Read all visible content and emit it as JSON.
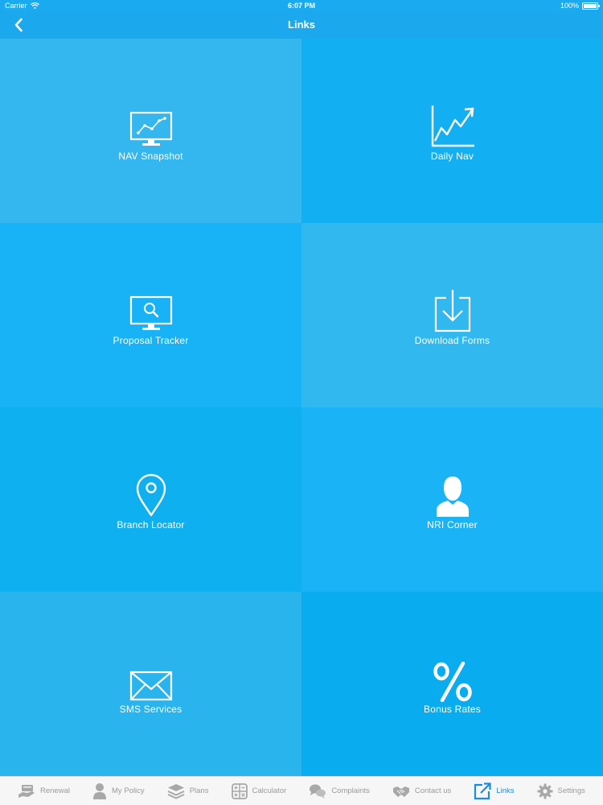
{
  "status_bar": {
    "carrier": "Carrier",
    "time": "6:07 PM",
    "battery": "100%"
  },
  "nav": {
    "title": "Links"
  },
  "tiles": [
    {
      "label": "NAV Snapshot",
      "icon": "monitor-chart-icon"
    },
    {
      "label": "Daily Nav",
      "icon": "line-chart-icon"
    },
    {
      "label": "Proposal Tracker",
      "icon": "monitor-search-icon"
    },
    {
      "label": "Download Forms",
      "icon": "download-icon"
    },
    {
      "label": "Branch Locator",
      "icon": "map-pin-icon"
    },
    {
      "label": "NRI Corner",
      "icon": "person-icon"
    },
    {
      "label": "SMS Services",
      "icon": "envelope-icon"
    },
    {
      "label": "Bonus Rates",
      "icon": "percent-icon"
    }
  ],
  "tab_bar": {
    "items": [
      {
        "label": "Renewal",
        "icon": "renewal-icon"
      },
      {
        "label": "My Policy",
        "icon": "user-icon"
      },
      {
        "label": "Plans",
        "icon": "layers-icon"
      },
      {
        "label": "Calculator",
        "icon": "calculator-icon"
      },
      {
        "label": "Complaints",
        "icon": "chat-icon"
      },
      {
        "label": "Contact us",
        "icon": "handshake-icon"
      },
      {
        "label": "Links",
        "icon": "external-link-icon",
        "active": true
      },
      {
        "label": "Settings",
        "icon": "gear-icon"
      }
    ]
  },
  "colors": {
    "accent": "#1a8de0",
    "tab_inactive": "#9a9a9a",
    "nav_bg": "#1ca8ec"
  }
}
